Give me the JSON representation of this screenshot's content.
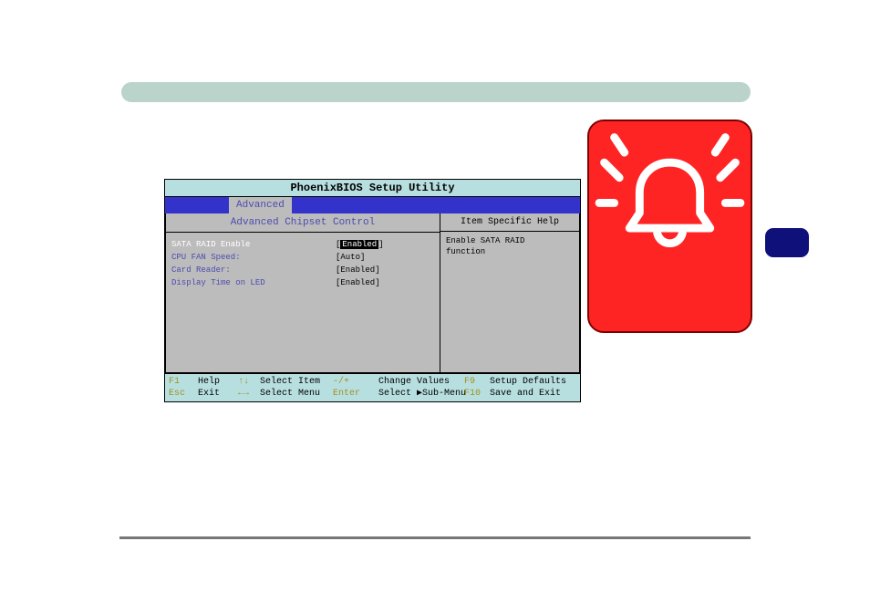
{
  "bios": {
    "title": "PhoenixBIOS Setup Utility",
    "tab": "Advanced",
    "subhead_left": "Advanced Chipset Control",
    "subhead_right": "Item Specific Help",
    "options": [
      {
        "label": "SATA RAID Enable",
        "value": "Enabled",
        "selected": true,
        "label_white": true
      },
      {
        "label": "CPU FAN Speed:",
        "value": "[Auto]"
      },
      {
        "label": "Card Reader:",
        "value": "[Enabled]"
      },
      {
        "label": "Display Time on LED",
        "value": "[Enabled]"
      }
    ],
    "help_lines": [
      "Enable SATA RAID",
      "function"
    ],
    "footer": {
      "l1": {
        "k1": "F1",
        "t1": "Help",
        "a1": "↑↓",
        "t2": "Select Item",
        "k2": "-/+",
        "t3": "Change Values",
        "k3": "F9",
        "t4": "Setup Defaults"
      },
      "l2": {
        "k1": "Esc",
        "t1": "Exit",
        "a1": "←→",
        "t2": "Select Menu",
        "k2": "Enter",
        "t3": "Select ▶Sub-Menu",
        "k3": "F10",
        "t4": "Save and Exit"
      }
    }
  }
}
